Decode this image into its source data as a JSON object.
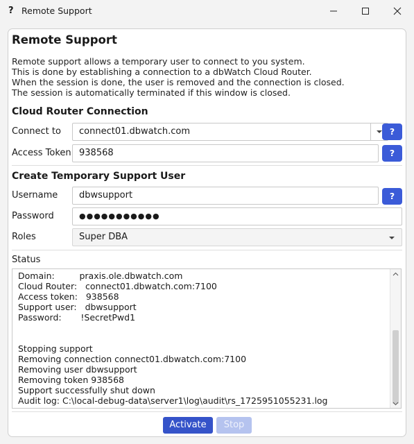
{
  "window": {
    "app_icon": "?",
    "title": "Remote Support",
    "controls": {
      "minimize": "minimize-icon",
      "maximize": "maximize-icon",
      "close": "close-icon"
    }
  },
  "page": {
    "title": "Remote Support",
    "description": "Remote support allows a temporary user to connect to you system.\nThis is done by establishing a connection to a dbWatch Cloud Router.\nWhen the session is done, the user is removed and the connection is closed.\nThe session is automatically terminated if this window is closed."
  },
  "cloud_router": {
    "heading": "Cloud Router Connection",
    "connect_to_label": "Connect to",
    "connect_to_value": "connect01.dbwatch.com",
    "access_token_label": "Access Token",
    "access_token_value": "938568",
    "help_label": "?"
  },
  "support_user": {
    "heading": "Create Temporary Support User",
    "username_label": "Username",
    "username_value": "dbwsupport",
    "password_label": "Password",
    "password_value": "●●●●●●●●●●●",
    "roles_label": "Roles",
    "roles_value": "Super DBA",
    "help_label": "?"
  },
  "status": {
    "label": "Status",
    "log": "Domain:         praxis.ole.dbwatch.com\nCloud Router:   connect01.dbwatch.com:7100\nAccess token:   938568\nSupport user:   dbwsupport\nPassword:       !SecretPwd1\n\n\nStopping support\nRemoving connection connect01.dbwatch.com:7100\nRemoving user dbwsupport\nRemoving token 938568\nSupport successfully shut down\nAudit log: C:\\local-debug-data\\server1\\log\\audit\\rs_1725951055231.log"
  },
  "actions": {
    "activate_label": "Activate",
    "stop_label": "Stop"
  },
  "colors": {
    "accent": "#3553c9",
    "help_button": "#3b5bd8",
    "disabled_button": "#b5c3ef"
  }
}
